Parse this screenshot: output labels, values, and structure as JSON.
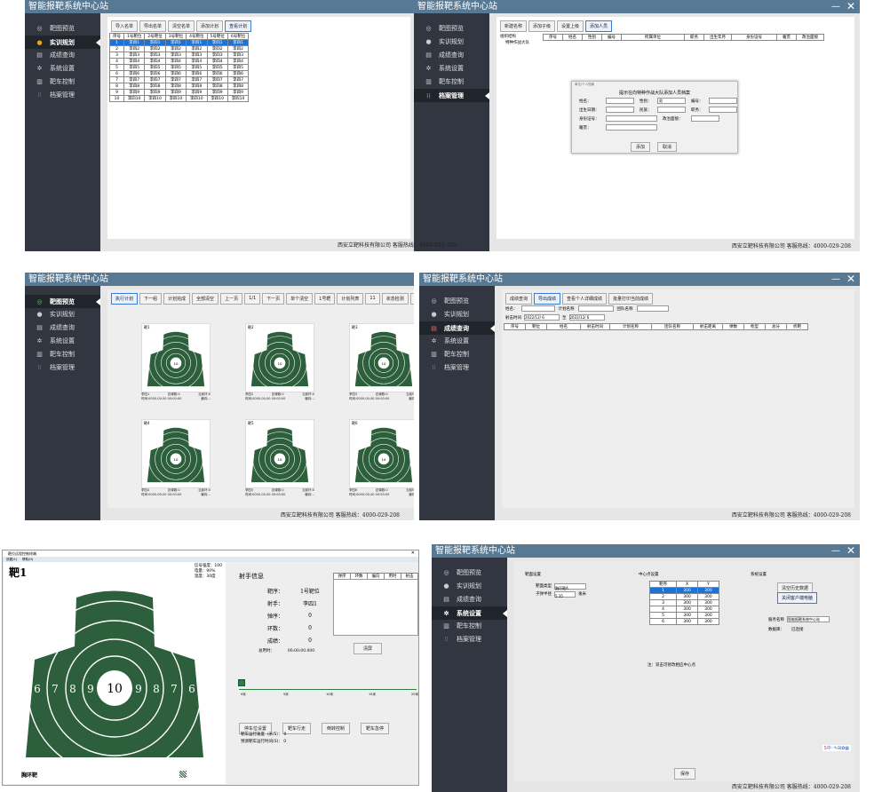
{
  "app_title": "智能报靶系统中心站",
  "sidebar": [
    "靶图预览",
    "实训规划",
    "成绩查询",
    "系统设置",
    "靶车控制",
    "档案管理"
  ],
  "footer": "西安立靶科技有限公司  客服热线：4000-029-208",
  "footer_company": "西安立靶科技有限公司",
  "footer_phone": "客服热线：4000-029-208",
  "w1": {
    "buttons": [
      "导入名单",
      "导出名单",
      "清空名单",
      "添加计划",
      "查看计划"
    ],
    "headers": [
      "序号",
      "1号靶位",
      "2号靶位",
      "3号靶位",
      "4号靶位",
      "5号靶位",
      "6号靶位"
    ],
    "rows": [
      [
        "1",
        "李四1",
        "李四1",
        "李四1",
        "李四1",
        "李四1",
        "李四1"
      ],
      [
        "2",
        "李四2",
        "李四2",
        "李四2",
        "李四2",
        "李四2",
        "李四2"
      ],
      [
        "3",
        "李四3",
        "李四3",
        "李四3",
        "李四3",
        "李四3",
        "李四3"
      ],
      [
        "4",
        "李四4",
        "李四4",
        "李四4",
        "李四4",
        "李四4",
        "李四4"
      ],
      [
        "5",
        "李四5",
        "李四5",
        "李四5",
        "李四5",
        "李四5",
        "李四5"
      ],
      [
        "6",
        "李四6",
        "李四6",
        "李四6",
        "李四6",
        "李四6",
        "李四6"
      ],
      [
        "7",
        "李四7",
        "李四7",
        "李四7",
        "李四7",
        "李四7",
        "李四7"
      ],
      [
        "8",
        "李四8",
        "李四8",
        "李四8",
        "李四8",
        "李四8",
        "李四8"
      ],
      [
        "9",
        "李四9",
        "李四9",
        "李四9",
        "李四9",
        "李四9",
        "李四9"
      ],
      [
        "10",
        "李四10",
        "李四10",
        "李四10",
        "李四10",
        "李四10",
        "李四10"
      ]
    ]
  },
  "w2": {
    "buttons": [
      "新建名称",
      "添加子级",
      "设置上级",
      "添加人员"
    ],
    "tree": [
      "组织结构",
      "特种作战大队"
    ],
    "headers": [
      "序号",
      "姓名",
      "性别",
      "编号",
      "所属单位",
      "职务",
      "出生年月",
      "身份证号",
      "籍贯",
      "政治面貌"
    ],
    "dialog": {
      "title": "单位/个人档案",
      "heading": "提示在向特种作战大队添加人员档案",
      "fields": [
        "姓名：",
        "性别：",
        "编号：",
        "出生日期：",
        "民族：",
        "职务：",
        "身份证号：",
        "政治面貌：",
        "籍贯："
      ],
      "gender_value": "男",
      "ok": "添加",
      "cancel": "取消"
    }
  },
  "w3": {
    "buttons": [
      "执行计划",
      "下一组",
      "计划完成",
      "全部清空",
      "上一页",
      "1/1",
      "下一页",
      "单个清空",
      "1号靶",
      "计划列表",
      "11",
      "状态检测",
      "定时射击",
      "定情射击"
    ],
    "targets": [
      {
        "label": "靶1",
        "shooter": "李四1",
        "count": "总弹数:0",
        "score": "当前环:0",
        "time": "时间:0000-00-00 00:00:00",
        "dir": "偏向:--"
      },
      {
        "label": "靶2",
        "shooter": "李四2",
        "count": "总弹数:0",
        "score": "当前环:0",
        "time": "时间:0000-00-00 00:00:00",
        "dir": "偏向:--"
      },
      {
        "label": "靶3",
        "shooter": "李四3",
        "count": "总弹数:0",
        "score": "当前环:0",
        "time": "时间:0000-00-00 00:00:00",
        "dir": "偏向:--"
      },
      {
        "label": "靶4",
        "shooter": "李四4",
        "count": "总弹数:0",
        "score": "当前环:0",
        "time": "时间:0000-00-00 00:00:00",
        "dir": "偏向:--"
      },
      {
        "label": "靶5",
        "shooter": "李四5",
        "count": "总弹数:0",
        "score": "当前环:0",
        "time": "时间:0000-00-00 00:00:00",
        "dir": "偏向:--"
      },
      {
        "label": "靶6",
        "shooter": "李四6",
        "count": "总弹数:0",
        "score": "当前环:0",
        "time": "时间:0000-00-00 00:00:00",
        "dir": "偏向:--"
      }
    ]
  },
  "w4": {
    "buttons": [
      "成绩查询",
      "导出成绩",
      "查看个人详细成绩",
      "批量打印当前成绩"
    ],
    "name_label": "姓名：",
    "plan_label": "计划名称",
    "team_label": "团队名称",
    "time_label": "射击时间",
    "date_from": "2022/12/ 6",
    "date_to": "2022/12/ 6",
    "to": "至",
    "headers": [
      "序号",
      "靶位",
      "姓名",
      "射击时间",
      "计划名称",
      "团队名称",
      "射击距离",
      "弹数",
      "枪型",
      "总分",
      "折靶"
    ]
  },
  "w5": {
    "title": "靶位远程控制终端",
    "menu": [
      "设置(S)",
      "帮助(H)"
    ],
    "target_label": "靶1",
    "signal": "信号强度：100",
    "battery": "电量：90%",
    "temp": "温度：30度",
    "bottom_label": "胸环靶",
    "rings": [
      "6",
      "7",
      "8",
      "9",
      "10",
      "9",
      "8",
      "7",
      "6"
    ],
    "shooter_info": "射手信息",
    "info_labels": [
      "靶序：",
      "射手：",
      "弹序：",
      "环数：",
      "成绩：",
      "总用时："
    ],
    "info_values": [
      "1号靶位",
      "李四1",
      "0",
      "0",
      "0",
      "00:00:00.000"
    ],
    "table_headers": [
      "弹序",
      "环数",
      "偏向",
      "用时",
      "射击"
    ],
    "clear_btn": "清屏",
    "scale": [
      "0米",
      "5米",
      "10米",
      "15米",
      "20米"
    ],
    "buttons": [
      "停车位设置",
      "靶车行走",
      "倒转控制",
      "靶车急停"
    ],
    "speed": "靶车运行速度（米/S）：  0",
    "est": "预测靶车运行时间(S)：  0"
  },
  "w6": {
    "sec1": "靶面设置",
    "type_label": "靶面类型",
    "type_value": "胸环靶A",
    "radius_label": "子弹半径",
    "radius_value": "5.35",
    "radius_unit": "毫米",
    "sec2": "中心点设置",
    "cp_headers": [
      "靶序",
      "X",
      "Y"
    ],
    "cp_rows": [
      [
        "1",
        "300",
        "300"
      ],
      [
        "2",
        "300",
        "300"
      ],
      [
        "3",
        "300",
        "300"
      ],
      [
        "4",
        "300",
        "300"
      ],
      [
        "5",
        "300",
        "300"
      ],
      [
        "6",
        "300",
        "300"
      ]
    ],
    "note": "注：双击可修改相应中心点",
    "sec3": "系统设置",
    "btn_history": "清空历史数据",
    "btn_close": "关闭客户端电脑",
    "server_label": "服务名称",
    "server_value": "智能报靶系统中心站",
    "db_label": "数据库：",
    "db_value": "已连接",
    "save": "保存"
  },
  "colors": {
    "title_bar": "#587994",
    "sidebar": "#323640",
    "target_green": "#2d5f3d",
    "selected": "#1a73d8"
  }
}
